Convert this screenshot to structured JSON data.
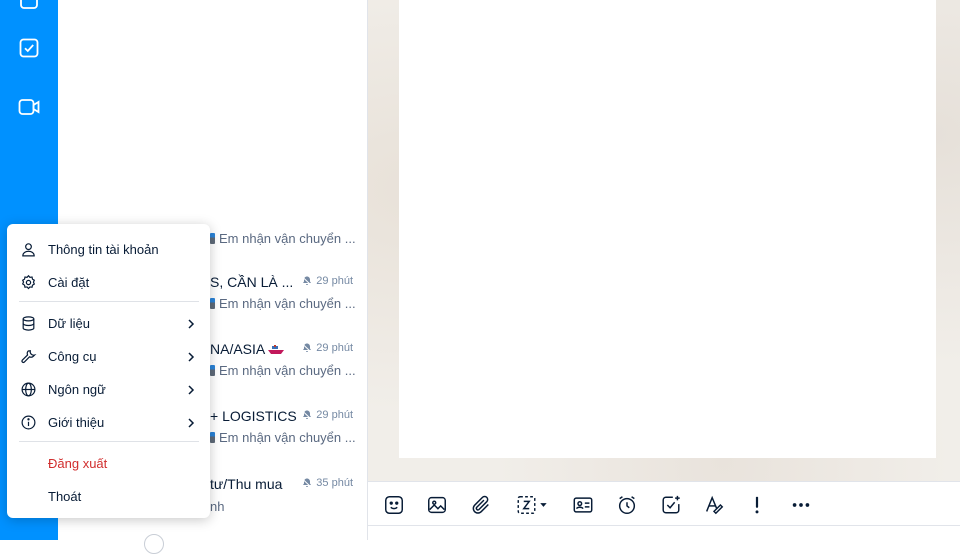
{
  "sidebar": {
    "icons": [
      "contacts-icon",
      "todo-checkbox-icon",
      "video-call-icon"
    ]
  },
  "conversations": [
    {
      "title": "",
      "time": "",
      "preview": "Em nhận vận chuyển ..."
    },
    {
      "title": "S, CẦN LÀ ...",
      "time": "29 phút",
      "preview": "Em nhận vận chuyển ..."
    },
    {
      "title": "NA/ASIA",
      "time": "29 phút",
      "preview": "Em nhận vận chuyển ..."
    },
    {
      "title": "+ LOGISTICS",
      "time": "29 phút",
      "preview": "Em nhận vận chuyển ..."
    },
    {
      "title": "tư/Thu mua",
      "time": "35 phút",
      "preview": "nh"
    }
  ],
  "account_menu": {
    "items": [
      {
        "label": "Thông tin tài khoản",
        "icon": "user-icon"
      },
      {
        "label": "Cài đặt",
        "icon": "gear-icon"
      },
      {
        "label": "Dữ liệu",
        "icon": "database-icon"
      },
      {
        "label": "Công cụ",
        "icon": "wrench-icon"
      },
      {
        "label": "Ngôn ngữ",
        "icon": "globe-icon"
      },
      {
        "label": "Giới thiệu",
        "icon": "info-icon"
      },
      {
        "label": "Đăng xuất"
      },
      {
        "label": "Thoát"
      }
    ]
  },
  "composer_toolbar": {
    "icons": [
      "sticker-icon",
      "image-icon",
      "attachment-icon",
      "screenshot-icon",
      "contact-card-icon",
      "reminder-clock-icon",
      "assign-task-icon",
      "text-format-icon",
      "urgent-icon",
      "more-icon"
    ]
  },
  "colors": {
    "rail": "#0091ff",
    "danger": "#d12e2e",
    "text": "#081c36",
    "muted": "#7589a3"
  }
}
